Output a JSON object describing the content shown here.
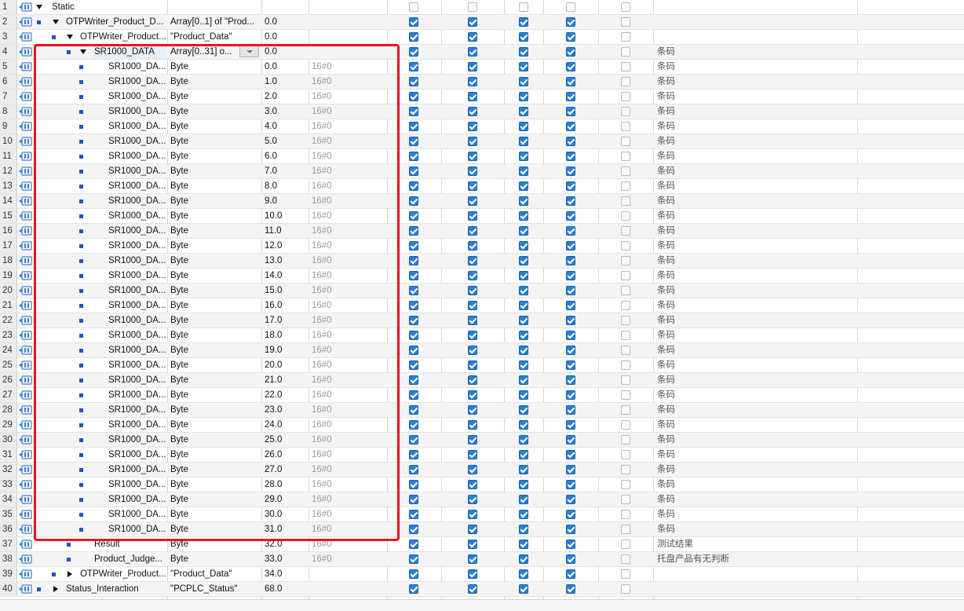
{
  "rows": [
    {
      "num": "1",
      "name": "Static",
      "type": "",
      "offset": "",
      "default": "",
      "comment": "",
      "level": 0,
      "expander": "down",
      "checks": [
        "off",
        "off",
        "off",
        "off",
        "off"
      ],
      "section": true
    },
    {
      "num": "2",
      "name": "OTPWriter_Product_D...",
      "type": "Array[0..1] of \"Prod...",
      "offset": "0.0",
      "default": "",
      "comment": "",
      "level": 1,
      "expander": "down",
      "checks": [
        "on",
        "on",
        "on",
        "on",
        "off"
      ]
    },
    {
      "num": "3",
      "name": "OTPWriter_Product...",
      "type": "\"Product_Data\"",
      "offset": "0.0",
      "default": "",
      "comment": "",
      "level": 2,
      "expander": "down",
      "checks": [
        "on",
        "on",
        "on",
        "on",
        "off"
      ]
    },
    {
      "num": "4",
      "name": "SR1000_DATA",
      "type": "Array[0..31] o...",
      "offset": "0.0",
      "default": "",
      "comment": "条码",
      "level": 3,
      "expander": "down",
      "checks": [
        "on",
        "on",
        "on",
        "on",
        "off"
      ],
      "selected": true,
      "dropdown": true
    },
    {
      "num": "5",
      "name": "SR1000_DA...",
      "type": "Byte",
      "offset": "0.0",
      "default": "16#0",
      "comment": "条码",
      "level": 4,
      "expander": "",
      "checks": [
        "on",
        "on",
        "on",
        "on",
        "off"
      ]
    },
    {
      "num": "6",
      "name": "SR1000_DA...",
      "type": "Byte",
      "offset": "1.0",
      "default": "16#0",
      "comment": "条码",
      "level": 4,
      "expander": "",
      "checks": [
        "on",
        "on",
        "on",
        "on",
        "off"
      ]
    },
    {
      "num": "7",
      "name": "SR1000_DA...",
      "type": "Byte",
      "offset": "2.0",
      "default": "16#0",
      "comment": "条码",
      "level": 4,
      "expander": "",
      "checks": [
        "on",
        "on",
        "on",
        "on",
        "off"
      ]
    },
    {
      "num": "8",
      "name": "SR1000_DA...",
      "type": "Byte",
      "offset": "3.0",
      "default": "16#0",
      "comment": "条码",
      "level": 4,
      "expander": "",
      "checks": [
        "on",
        "on",
        "on",
        "on",
        "off"
      ]
    },
    {
      "num": "9",
      "name": "SR1000_DA...",
      "type": "Byte",
      "offset": "4.0",
      "default": "16#0",
      "comment": "条码",
      "level": 4,
      "expander": "",
      "checks": [
        "on",
        "on",
        "on",
        "on",
        "off"
      ]
    },
    {
      "num": "10",
      "name": "SR1000_DA...",
      "type": "Byte",
      "offset": "5.0",
      "default": "16#0",
      "comment": "条码",
      "level": 4,
      "expander": "",
      "checks": [
        "on",
        "on",
        "on",
        "on",
        "off"
      ]
    },
    {
      "num": "11",
      "name": "SR1000_DA...",
      "type": "Byte",
      "offset": "6.0",
      "default": "16#0",
      "comment": "条码",
      "level": 4,
      "expander": "",
      "checks": [
        "on",
        "on",
        "on",
        "on",
        "off"
      ]
    },
    {
      "num": "12",
      "name": "SR1000_DA...",
      "type": "Byte",
      "offset": "7.0",
      "default": "16#0",
      "comment": "条码",
      "level": 4,
      "expander": "",
      "checks": [
        "on",
        "on",
        "on",
        "on",
        "off"
      ]
    },
    {
      "num": "13",
      "name": "SR1000_DA...",
      "type": "Byte",
      "offset": "8.0",
      "default": "16#0",
      "comment": "条码",
      "level": 4,
      "expander": "",
      "checks": [
        "on",
        "on",
        "on",
        "on",
        "off"
      ]
    },
    {
      "num": "14",
      "name": "SR1000_DA...",
      "type": "Byte",
      "offset": "9.0",
      "default": "16#0",
      "comment": "条码",
      "level": 4,
      "expander": "",
      "checks": [
        "on",
        "on",
        "on",
        "on",
        "off"
      ]
    },
    {
      "num": "15",
      "name": "SR1000_DA...",
      "type": "Byte",
      "offset": "10.0",
      "default": "16#0",
      "comment": "条码",
      "level": 4,
      "expander": "",
      "checks": [
        "on",
        "on",
        "on",
        "on",
        "off"
      ]
    },
    {
      "num": "16",
      "name": "SR1000_DA...",
      "type": "Byte",
      "offset": "11.0",
      "default": "16#0",
      "comment": "条码",
      "level": 4,
      "expander": "",
      "checks": [
        "on",
        "on",
        "on",
        "on",
        "off"
      ]
    },
    {
      "num": "17",
      "name": "SR1000_DA...",
      "type": "Byte",
      "offset": "12.0",
      "default": "16#0",
      "comment": "条码",
      "level": 4,
      "expander": "",
      "checks": [
        "on",
        "on",
        "on",
        "on",
        "off"
      ]
    },
    {
      "num": "18",
      "name": "SR1000_DA...",
      "type": "Byte",
      "offset": "13.0",
      "default": "16#0",
      "comment": "条码",
      "level": 4,
      "expander": "",
      "checks": [
        "on",
        "on",
        "on",
        "on",
        "off"
      ]
    },
    {
      "num": "19",
      "name": "SR1000_DA...",
      "type": "Byte",
      "offset": "14.0",
      "default": "16#0",
      "comment": "条码",
      "level": 4,
      "expander": "",
      "checks": [
        "on",
        "on",
        "on",
        "on",
        "off"
      ]
    },
    {
      "num": "20",
      "name": "SR1000_DA...",
      "type": "Byte",
      "offset": "15.0",
      "default": "16#0",
      "comment": "条码",
      "level": 4,
      "expander": "",
      "checks": [
        "on",
        "on",
        "on",
        "on",
        "off"
      ]
    },
    {
      "num": "21",
      "name": "SR1000_DA...",
      "type": "Byte",
      "offset": "16.0",
      "default": "16#0",
      "comment": "条码",
      "level": 4,
      "expander": "",
      "checks": [
        "on",
        "on",
        "on",
        "on",
        "off"
      ]
    },
    {
      "num": "22",
      "name": "SR1000_DA...",
      "type": "Byte",
      "offset": "17.0",
      "default": "16#0",
      "comment": "条码",
      "level": 4,
      "expander": "",
      "checks": [
        "on",
        "on",
        "on",
        "on",
        "off"
      ]
    },
    {
      "num": "23",
      "name": "SR1000_DA...",
      "type": "Byte",
      "offset": "18.0",
      "default": "16#0",
      "comment": "条码",
      "level": 4,
      "expander": "",
      "checks": [
        "on",
        "on",
        "on",
        "on",
        "off"
      ]
    },
    {
      "num": "24",
      "name": "SR1000_DA...",
      "type": "Byte",
      "offset": "19.0",
      "default": "16#0",
      "comment": "条码",
      "level": 4,
      "expander": "",
      "checks": [
        "on",
        "on",
        "on",
        "on",
        "off"
      ]
    },
    {
      "num": "25",
      "name": "SR1000_DA...",
      "type": "Byte",
      "offset": "20.0",
      "default": "16#0",
      "comment": "条码",
      "level": 4,
      "expander": "",
      "checks": [
        "on",
        "on",
        "on",
        "on",
        "off"
      ]
    },
    {
      "num": "26",
      "name": "SR1000_DA...",
      "type": "Byte",
      "offset": "21.0",
      "default": "16#0",
      "comment": "条码",
      "level": 4,
      "expander": "",
      "checks": [
        "on",
        "on",
        "on",
        "on",
        "off"
      ]
    },
    {
      "num": "27",
      "name": "SR1000_DA...",
      "type": "Byte",
      "offset": "22.0",
      "default": "16#0",
      "comment": "条码",
      "level": 4,
      "expander": "",
      "checks": [
        "on",
        "on",
        "on",
        "on",
        "off"
      ]
    },
    {
      "num": "28",
      "name": "SR1000_DA...",
      "type": "Byte",
      "offset": "23.0",
      "default": "16#0",
      "comment": "条码",
      "level": 4,
      "expander": "",
      "checks": [
        "on",
        "on",
        "on",
        "on",
        "off"
      ]
    },
    {
      "num": "29",
      "name": "SR1000_DA...",
      "type": "Byte",
      "offset": "24.0",
      "default": "16#0",
      "comment": "条码",
      "level": 4,
      "expander": "",
      "checks": [
        "on",
        "on",
        "on",
        "on",
        "off"
      ]
    },
    {
      "num": "30",
      "name": "SR1000_DA...",
      "type": "Byte",
      "offset": "25.0",
      "default": "16#0",
      "comment": "条码",
      "level": 4,
      "expander": "",
      "checks": [
        "on",
        "on",
        "on",
        "on",
        "off"
      ]
    },
    {
      "num": "31",
      "name": "SR1000_DA...",
      "type": "Byte",
      "offset": "26.0",
      "default": "16#0",
      "comment": "条码",
      "level": 4,
      "expander": "",
      "checks": [
        "on",
        "on",
        "on",
        "on",
        "off"
      ]
    },
    {
      "num": "32",
      "name": "SR1000_DA...",
      "type": "Byte",
      "offset": "27.0",
      "default": "16#0",
      "comment": "条码",
      "level": 4,
      "expander": "",
      "checks": [
        "on",
        "on",
        "on",
        "on",
        "off"
      ]
    },
    {
      "num": "33",
      "name": "SR1000_DA...",
      "type": "Byte",
      "offset": "28.0",
      "default": "16#0",
      "comment": "条码",
      "level": 4,
      "expander": "",
      "checks": [
        "on",
        "on",
        "on",
        "on",
        "off"
      ]
    },
    {
      "num": "34",
      "name": "SR1000_DA...",
      "type": "Byte",
      "offset": "29.0",
      "default": "16#0",
      "comment": "条码",
      "level": 4,
      "expander": "",
      "checks": [
        "on",
        "on",
        "on",
        "on",
        "off"
      ]
    },
    {
      "num": "35",
      "name": "SR1000_DA...",
      "type": "Byte",
      "offset": "30.0",
      "default": "16#0",
      "comment": "条码",
      "level": 4,
      "expander": "",
      "checks": [
        "on",
        "on",
        "on",
        "on",
        "off"
      ]
    },
    {
      "num": "36",
      "name": "SR1000_DA...",
      "type": "Byte",
      "offset": "31.0",
      "default": "16#0",
      "comment": "条码",
      "level": 4,
      "expander": "",
      "checks": [
        "on",
        "on",
        "on",
        "on",
        "off"
      ]
    },
    {
      "num": "37",
      "name": "Result",
      "type": "Byte",
      "offset": "32.0",
      "default": "16#0",
      "comment": "测试结果",
      "level": 3,
      "expander": "",
      "checks": [
        "on",
        "on",
        "on",
        "on",
        "off"
      ]
    },
    {
      "num": "38",
      "name": "Product_Judge...",
      "type": "Byte",
      "offset": "33.0",
      "default": "16#0",
      "comment": "托盘产品有无判断",
      "level": 3,
      "expander": "",
      "checks": [
        "on",
        "on",
        "on",
        "on",
        "off"
      ]
    },
    {
      "num": "39",
      "name": "OTPWriter_Product...",
      "type": "\"Product_Data\"",
      "offset": "34.0",
      "default": "",
      "comment": "",
      "level": 2,
      "expander": "right",
      "checks": [
        "on",
        "on",
        "on",
        "on",
        "off"
      ]
    },
    {
      "num": "40",
      "name": "Status_Interaction",
      "type": "\"PCPLC_Status\"",
      "offset": "68.0",
      "default": "",
      "comment": "",
      "level": 1,
      "expander": "right",
      "checks": [
        "on",
        "on",
        "on",
        "on",
        "off"
      ]
    }
  ],
  "colors": {
    "highlight": "#e8151f",
    "checkbox": "#2a7fd6",
    "io_icon": "#3b7fcf"
  },
  "icons": {
    "interface": "db-interface-icon"
  }
}
